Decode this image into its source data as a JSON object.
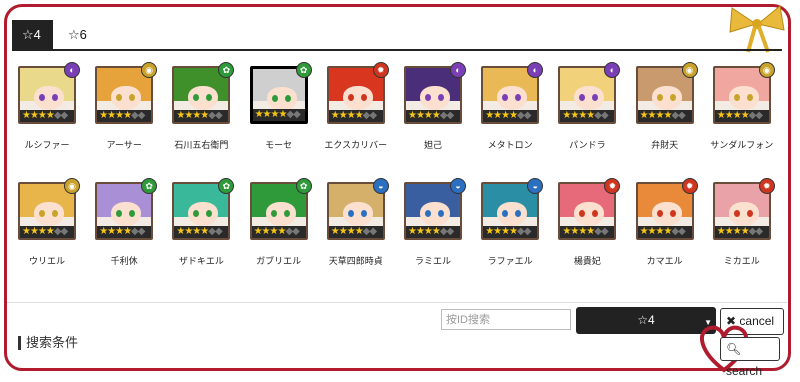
{
  "tabs": [
    {
      "label": "☆4",
      "active": true
    },
    {
      "label": "☆6",
      "active": false
    }
  ],
  "colors": {
    "frame": "#b01c2e",
    "gold": "#f5c518",
    "dark": "#222222"
  },
  "characters": [
    {
      "name": "ルシファー",
      "element": "dark",
      "hair": "#e9d98a"
    },
    {
      "name": "アーサー",
      "element": "light",
      "hair": "#e6a33c"
    },
    {
      "name": "石川五右衛門",
      "element": "wood",
      "hair": "#3f8f2a"
    },
    {
      "name": "モーセ",
      "element": "wood",
      "hair": "#cfcfcf",
      "selected": true
    },
    {
      "name": "エクスカリバー",
      "element": "fire",
      "hair": "#d8361f"
    },
    {
      "name": "妲己",
      "element": "dark",
      "hair": "#4a2e7a"
    },
    {
      "name": "メタトロン",
      "element": "dark",
      "hair": "#e9b955"
    },
    {
      "name": "パンドラ",
      "element": "dark",
      "hair": "#f1d27a"
    },
    {
      "name": "弁財天",
      "element": "light",
      "hair": "#c99a6d"
    },
    {
      "name": "サンダルフォン",
      "element": "light",
      "hair": "#f0a7a0"
    },
    {
      "name": "ウリエル",
      "element": "light",
      "hair": "#e8b54a"
    },
    {
      "name": "千利休",
      "element": "wood",
      "hair": "#a98fd6"
    },
    {
      "name": "ザドキエル",
      "element": "wood",
      "hair": "#39b99a"
    },
    {
      "name": "ガブリエル",
      "element": "wood",
      "hair": "#2f9a3a"
    },
    {
      "name": "天草四郎時貞",
      "element": "water",
      "hair": "#d4b06a"
    },
    {
      "name": "ラミエル",
      "element": "water",
      "hair": "#3a5fa0"
    },
    {
      "name": "ラファエル",
      "element": "water",
      "hair": "#2a8fa5"
    },
    {
      "name": "楊貴妃",
      "element": "fire",
      "hair": "#e66a7a"
    },
    {
      "name": "カマエル",
      "element": "fire",
      "hair": "#e88a3a"
    },
    {
      "name": "ミカエル",
      "element": "fire",
      "hair": "#e8a2a8"
    }
  ],
  "element_colors": {
    "dark": "#7b3fb5",
    "light": "#c9a22a",
    "wood": "#2f9a3a",
    "fire": "#d0361f",
    "water": "#2a6fc0"
  },
  "element_glyphs": {
    "dark": "◐",
    "light": "◉",
    "wood": "✿",
    "fire": "✹",
    "water": "◒"
  },
  "stars": "★★★★",
  "search": {
    "section_title": "搜索条件",
    "id_placeholder": "按ID搜索",
    "rarity_value": "☆4",
    "cancel_label": "cancel",
    "search_label": "search"
  }
}
